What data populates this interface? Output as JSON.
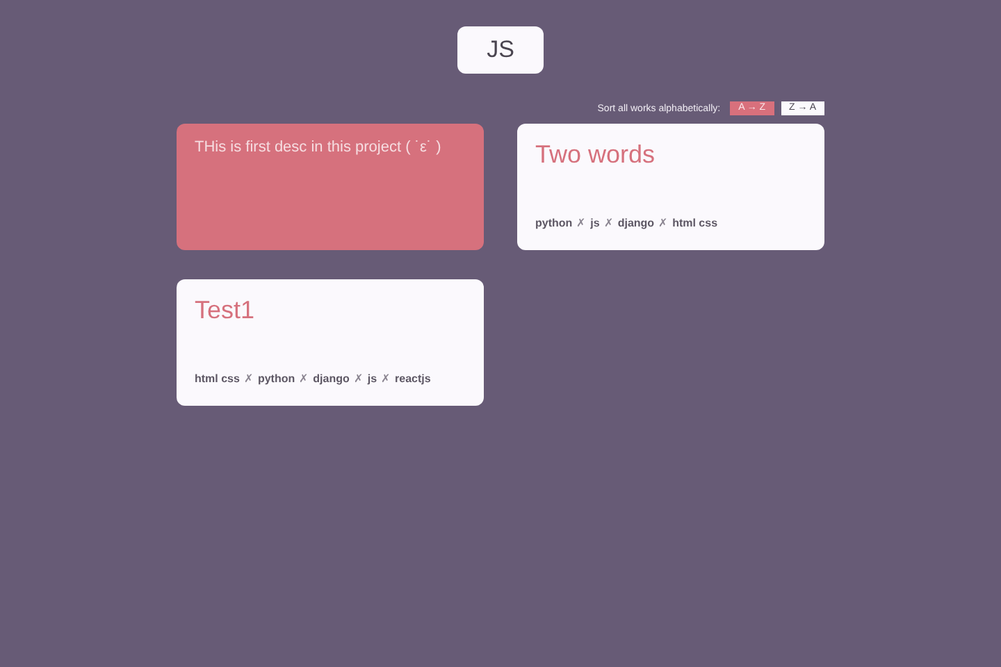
{
  "filter_button": {
    "label": "JS"
  },
  "sort": {
    "label": "Sort all works alphabetically:",
    "options": [
      {
        "label": "A → Z",
        "selected": true
      },
      {
        "label": "Z → A",
        "selected": false
      }
    ]
  },
  "tag_separator": "✗",
  "projects": [
    {
      "hovered": true,
      "description": "THis is first desc in this project ( ˙ε˙ )"
    },
    {
      "hovered": false,
      "title": "Two words",
      "tags": [
        "python",
        "js",
        "django",
        "html css"
      ]
    },
    {
      "hovered": false,
      "title": "Test1",
      "tags": [
        "html css",
        "python",
        "django",
        "js",
        "reactjs"
      ]
    }
  ]
}
